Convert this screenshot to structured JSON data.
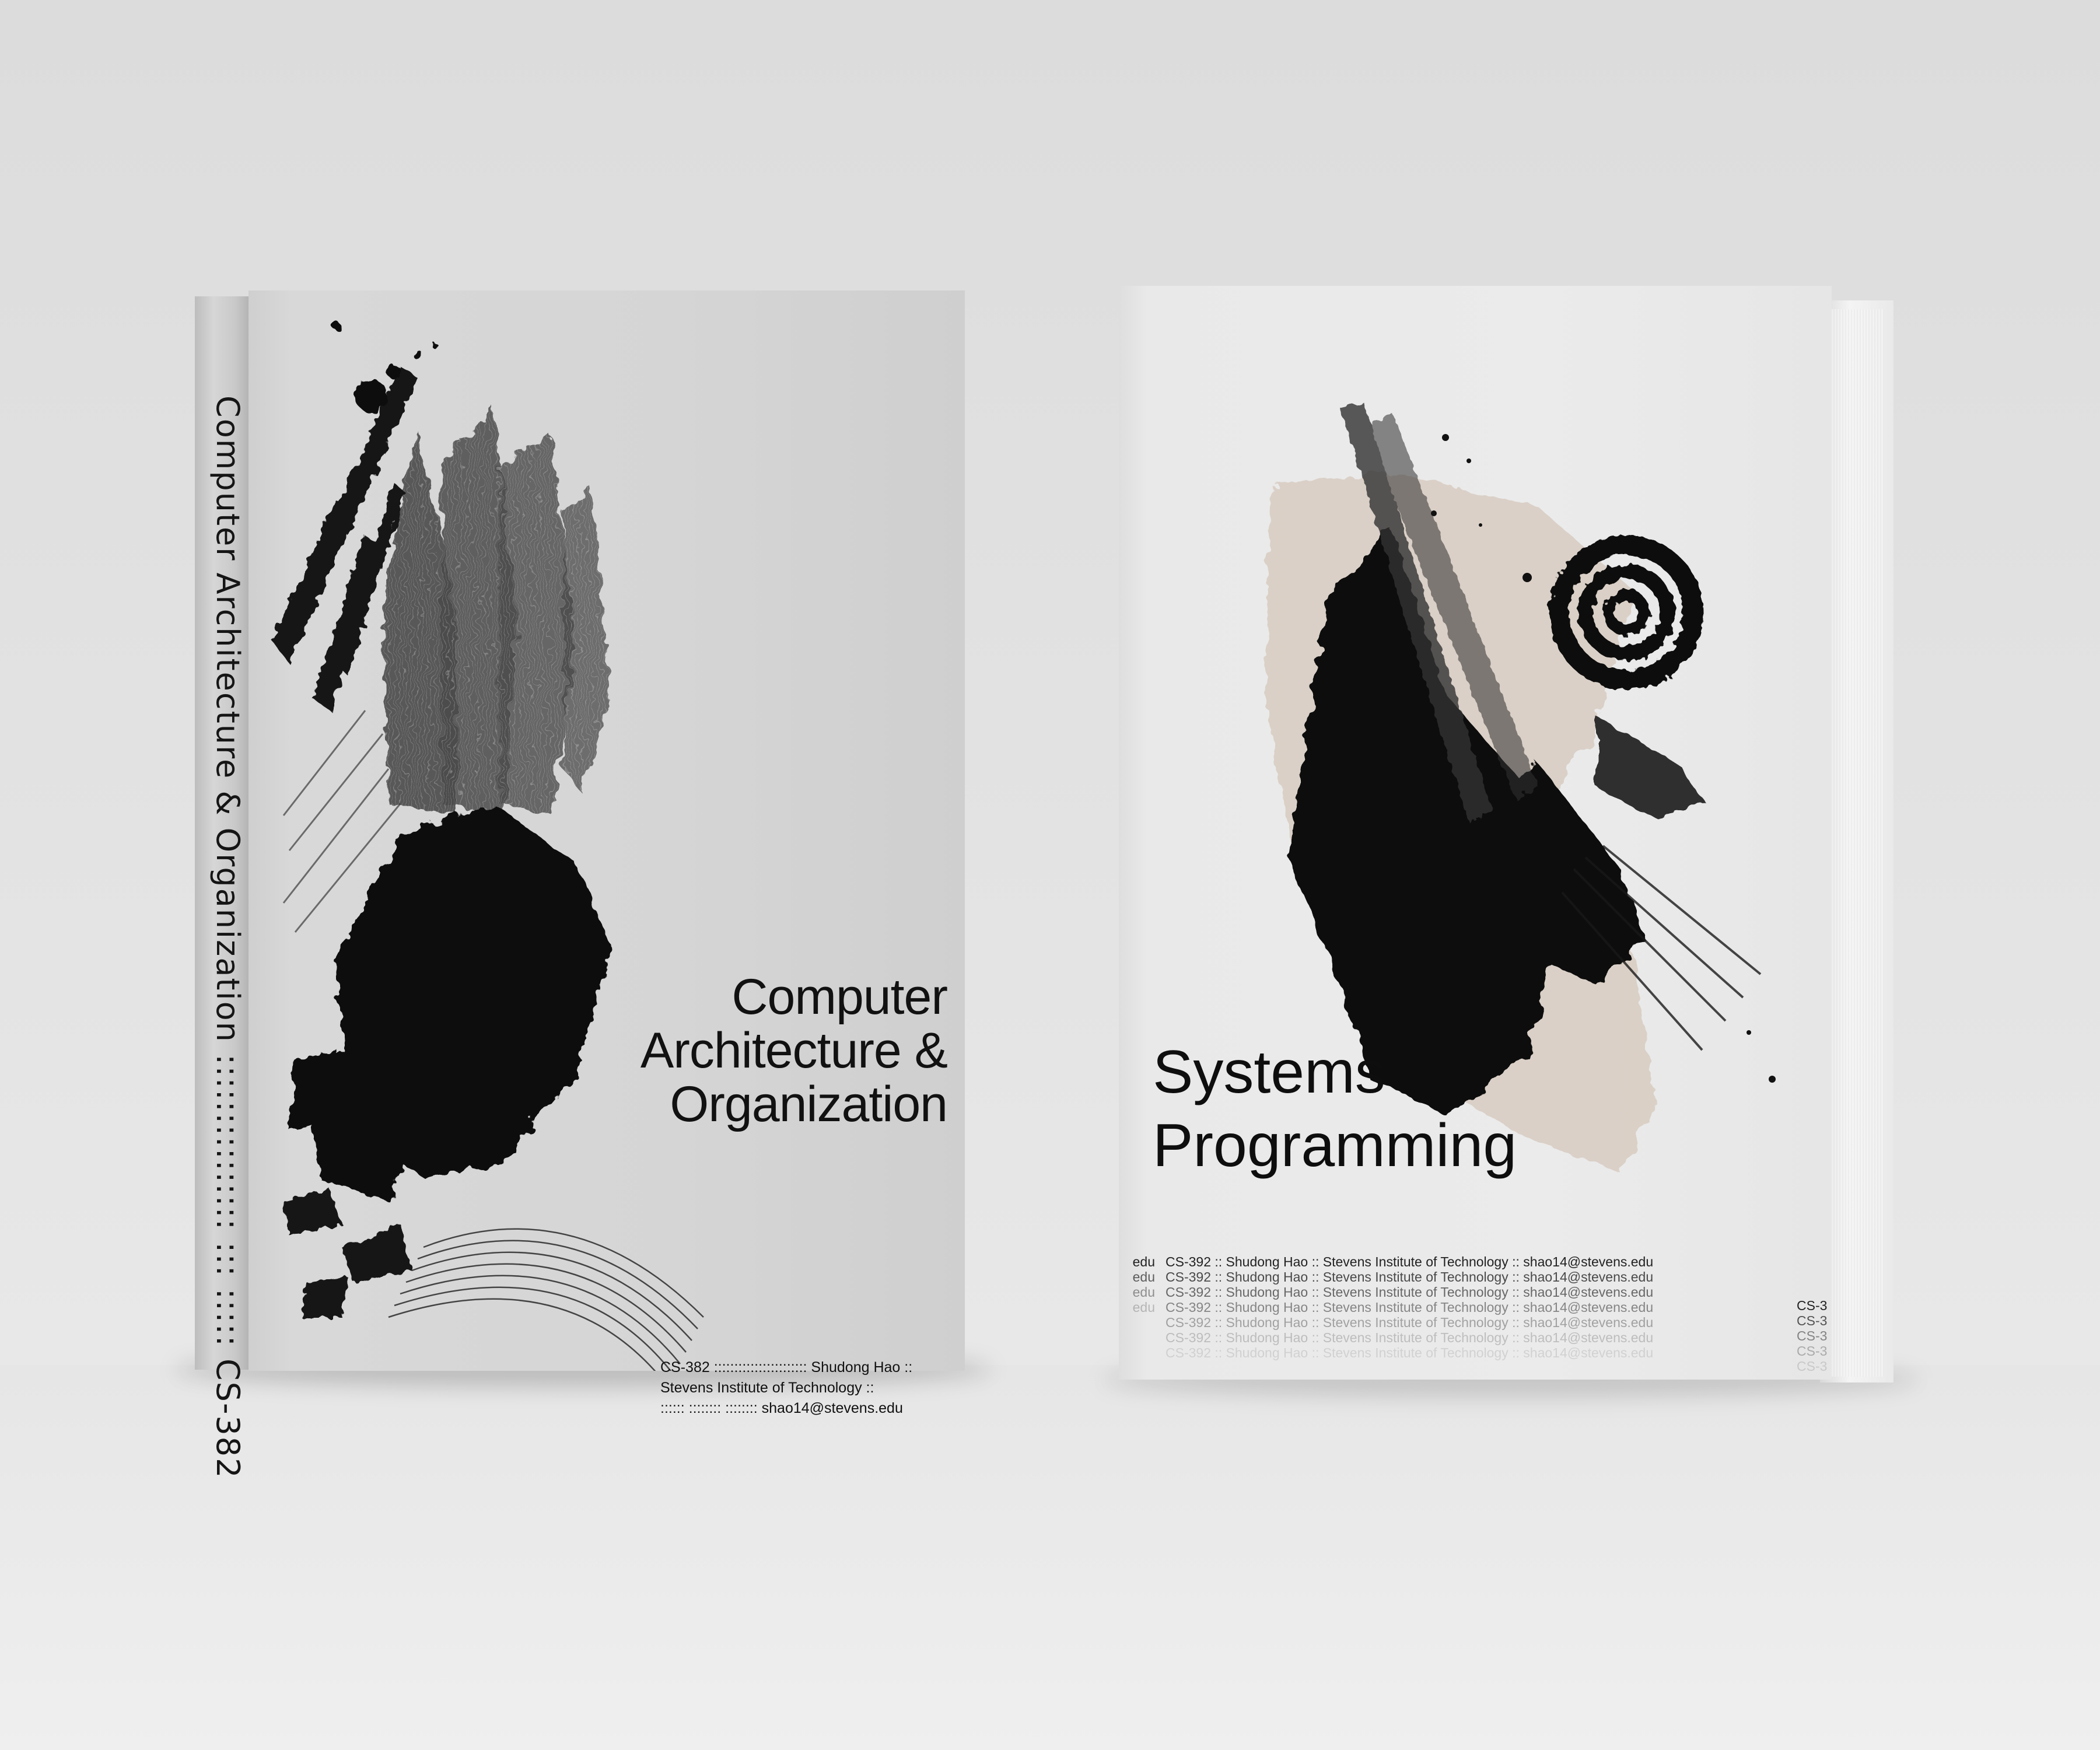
{
  "book_left": {
    "spine_title": "Computer Architecture & Organization ::::::::::::::: ::: ::::: CS-382",
    "title_lines": [
      "Computer",
      "Architecture &",
      "Organization"
    ],
    "meta_lines": [
      "CS-382 ::::::::::::::::::::::: Shudong Hao ::",
      "Stevens Institute of Technology ::",
      ":::::: :::::::: :::::::: shao14@stevens.edu"
    ]
  },
  "book_right": {
    "title_lines": [
      "Systems",
      "Programming"
    ],
    "info_line": "CS-392 :: Shudong Hao :: Stevens Institute of Technology :: shao14@stevens.edu",
    "left_stub": "edu",
    "right_stub": "CS-3",
    "accent_color": "#d8ccc1"
  }
}
